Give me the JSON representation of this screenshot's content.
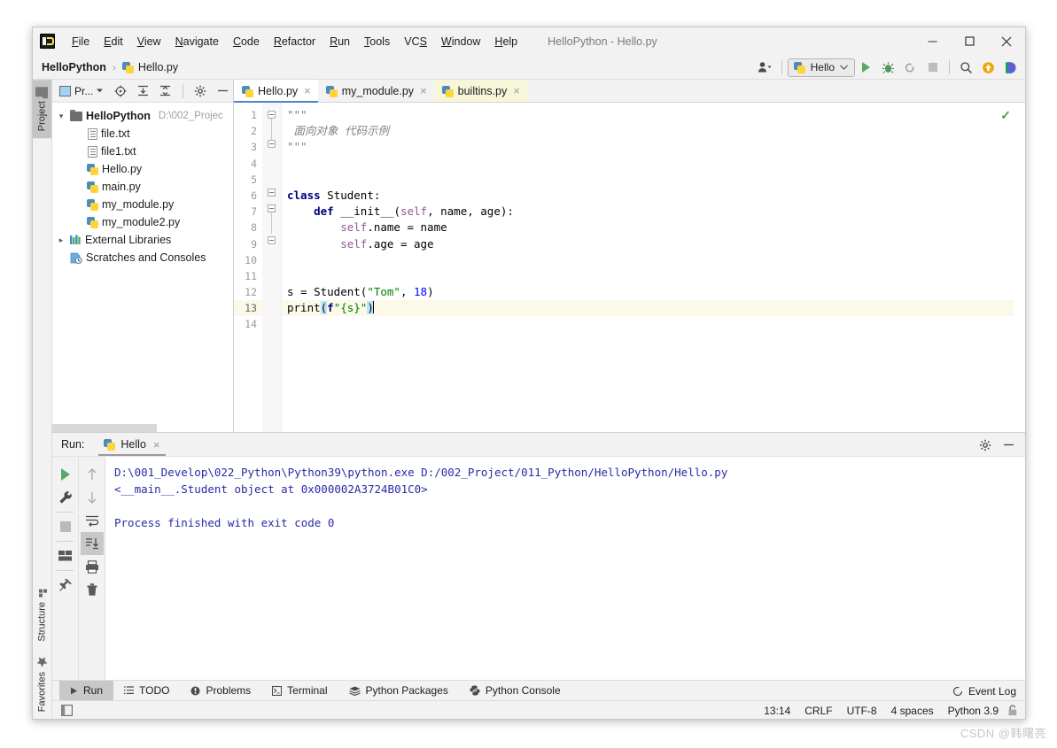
{
  "window": {
    "title": "HelloPython - Hello.py",
    "app_icon": "pycharm-logo-icon",
    "controls": {
      "minimize": "minimize-icon",
      "maximize": "maximize-icon",
      "close": "close-icon"
    }
  },
  "menubar": {
    "items": [
      {
        "label": "File",
        "mnemonic": "F"
      },
      {
        "label": "Edit",
        "mnemonic": "E"
      },
      {
        "label": "View",
        "mnemonic": "V"
      },
      {
        "label": "Navigate",
        "mnemonic": "N"
      },
      {
        "label": "Code",
        "mnemonic": "C"
      },
      {
        "label": "Refactor",
        "mnemonic": "R"
      },
      {
        "label": "Run",
        "mnemonic": "R"
      },
      {
        "label": "Tools",
        "mnemonic": "T"
      },
      {
        "label": "VCS",
        "mnemonic": "S"
      },
      {
        "label": "Window",
        "mnemonic": "W"
      },
      {
        "label": "Help",
        "mnemonic": "H"
      }
    ]
  },
  "navbar": {
    "breadcrumbs": [
      {
        "label": "HelloPython",
        "icon": ""
      },
      {
        "label": "Hello.py",
        "icon": "python-file-icon"
      }
    ],
    "separator": "›",
    "run_config": {
      "label": "Hello",
      "icon": "python-file-icon",
      "chevron": "chevron-down-icon"
    },
    "buttons": [
      {
        "name": "user-account-icon",
        "label": ""
      },
      {
        "name": "run-button",
        "label": ""
      },
      {
        "name": "debug-button",
        "label": ""
      },
      {
        "name": "run-coverage-button",
        "label": ""
      },
      {
        "name": "stop-button",
        "label": ""
      },
      {
        "name": "search-everywhere-icon",
        "label": ""
      },
      {
        "name": "update-project-icon",
        "label": ""
      },
      {
        "name": "datalore-icon",
        "label": ""
      }
    ]
  },
  "left_rail": {
    "top": [
      {
        "label": "Project",
        "icon": "folder-icon",
        "active": true
      }
    ],
    "bottom": [
      {
        "label": "Structure",
        "icon": "structure-icon",
        "active": false
      },
      {
        "label": "Favorites",
        "icon": "star-icon",
        "active": false
      }
    ]
  },
  "project_panel": {
    "title": "Pr...",
    "header_icons": [
      "select-opened-file-icon",
      "expand-all-icon",
      "collapse-all-icon",
      "settings-gear-icon",
      "hide-icon"
    ],
    "tree": [
      {
        "depth": 0,
        "arrow": "⌄",
        "label": "HelloPython",
        "bold": true,
        "icon": "folder-icon",
        "path": "D:\\002_Projec"
      },
      {
        "depth": 1,
        "arrow": "",
        "label": "file.txt",
        "bold": false,
        "icon": "text-file-icon",
        "path": ""
      },
      {
        "depth": 1,
        "arrow": "",
        "label": "file1.txt",
        "bold": false,
        "icon": "text-file-icon",
        "path": ""
      },
      {
        "depth": 1,
        "arrow": "",
        "label": "Hello.py",
        "bold": false,
        "icon": "python-file-icon",
        "path": ""
      },
      {
        "depth": 1,
        "arrow": "",
        "label": "main.py",
        "bold": false,
        "icon": "python-file-icon",
        "path": ""
      },
      {
        "depth": 1,
        "arrow": "",
        "label": "my_module.py",
        "bold": false,
        "icon": "python-file-icon",
        "path": ""
      },
      {
        "depth": 1,
        "arrow": "",
        "label": "my_module2.py",
        "bold": false,
        "icon": "python-file-icon",
        "path": ""
      },
      {
        "depth": 0,
        "arrow": "›",
        "label": "External Libraries",
        "bold": false,
        "icon": "libraries-icon",
        "path": ""
      },
      {
        "depth": 0,
        "arrow": "",
        "label": "Scratches and Consoles",
        "bold": false,
        "icon": "scratches-icon",
        "path": ""
      }
    ]
  },
  "editor": {
    "tabs": [
      {
        "label": "Hello.py",
        "icon": "python-file-icon",
        "state": "active"
      },
      {
        "label": "my_module.py",
        "icon": "python-file-icon",
        "state": "normal"
      },
      {
        "label": "builtins.py",
        "icon": "python-file-icon",
        "state": "highlight"
      }
    ],
    "close_glyph": "×",
    "inspection_status": "ok-check-icon",
    "line_numbers": [
      "1",
      "2",
      "3",
      "4",
      "5",
      "6",
      "7",
      "8",
      "9",
      "10",
      "11",
      "12",
      "13",
      "14"
    ],
    "current_line": 13,
    "lines": [
      {
        "n": 1,
        "text": "\"\"\""
      },
      {
        "n": 2,
        "text": "面向对象 代码示例"
      },
      {
        "n": 3,
        "text": "\"\"\""
      },
      {
        "n": 4,
        "text": ""
      },
      {
        "n": 5,
        "text": ""
      },
      {
        "n": 6,
        "text": "class Student:"
      },
      {
        "n": 7,
        "text": "    def __init__(self, name, age):"
      },
      {
        "n": 8,
        "text": "        self.name = name"
      },
      {
        "n": 9,
        "text": "        self.age = age"
      },
      {
        "n": 10,
        "text": ""
      },
      {
        "n": 11,
        "text": ""
      },
      {
        "n": 12,
        "text": "s = Student(\"Tom\", 18)"
      },
      {
        "n": 13,
        "text": "print(f\"{s}\")"
      },
      {
        "n": 14,
        "text": ""
      }
    ]
  },
  "run_panel": {
    "label": "Run:",
    "tab": {
      "label": "Hello",
      "icon": "python-file-icon",
      "close": "×"
    },
    "header_buttons": [
      "settings-gear-icon",
      "hide-panel-icon"
    ],
    "toolbar_left": [
      "rerun-button",
      "wrench-settings-button",
      "stop-button",
      "show-layout-button",
      "pin-tab-button"
    ],
    "toolbar_right": [
      "up-arrow-button",
      "down-arrow-button",
      "soft-wrap-button",
      "scroll-to-end-button",
      "print-button",
      "clear-all-button"
    ],
    "console_lines": [
      "D:\\001_Develop\\022_Python\\Python39\\python.exe D:/002_Project/011_Python/HelloPython/Hello.py",
      "<__main__.Student object at 0x000002A3724B01C0>",
      "",
      "Process finished with exit code 0"
    ]
  },
  "toolwindow_bar": {
    "items": [
      {
        "label": "Run",
        "icon": "run-triangle-icon",
        "active": true
      },
      {
        "label": "TODO",
        "icon": "todo-list-icon",
        "active": false
      },
      {
        "label": "Problems",
        "icon": "problems-icon",
        "active": false
      },
      {
        "label": "Terminal",
        "icon": "terminal-icon",
        "active": false
      },
      {
        "label": "Python Packages",
        "icon": "packages-icon",
        "active": false
      },
      {
        "label": "Python Console",
        "icon": "python-console-icon",
        "active": false
      }
    ],
    "event_log": {
      "label": "Event Log",
      "icon": "event-log-icon"
    }
  },
  "statusbar": {
    "left_icon": "toggle-toolwindow-icon",
    "items": [
      {
        "name": "caret-position",
        "label": "13:14"
      },
      {
        "name": "line-separator",
        "label": "CRLF"
      },
      {
        "name": "file-encoding",
        "label": "UTF-8"
      },
      {
        "name": "indent-size",
        "label": "4 spaces"
      },
      {
        "name": "python-interpreter",
        "label": "Python 3.9"
      }
    ],
    "lock_icon": "readonly-lock-icon"
  },
  "watermark": {
    "text": "CSDN @韩曙亮"
  },
  "colors": {
    "accent_blue": "#4a86c8",
    "run_green": "#59a869",
    "keyword_navy": "#000080",
    "string_green": "#008000",
    "self_purple": "#94558d",
    "number_blue": "#0000ff",
    "console_blue": "#2a2aa5",
    "current_line_bg": "#fcf9e8",
    "bracket_highlight": "#b9e4fb",
    "tab_highlight_bg": "#f7f5da"
  }
}
